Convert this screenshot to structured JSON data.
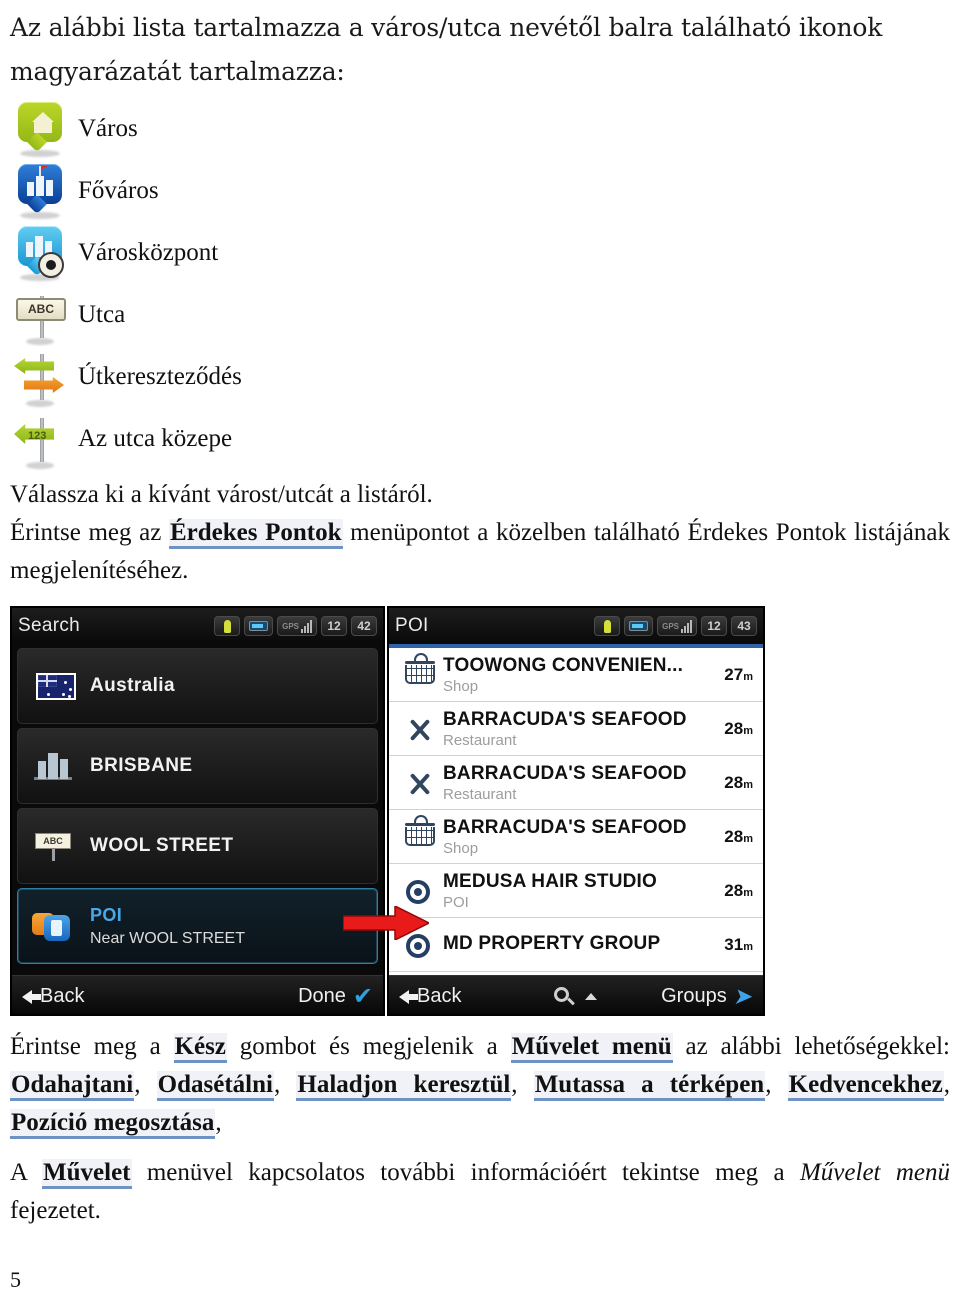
{
  "document": {
    "intro_heading": "Az alábbi lista tartalmazza a város/utca nevétől balra található ikonok magyarázatát tartalmazza:",
    "page_number": "5"
  },
  "icon_legend": {
    "items": [
      {
        "icon": "green-house-pin-icon",
        "label": "Város"
      },
      {
        "icon": "blue-capital-city-pin-icon",
        "label": "Főváros"
      },
      {
        "icon": "cyan-city-centre-pin-icon",
        "label": "Városközpont"
      },
      {
        "icon": "abc-street-sign-icon",
        "label": "Utca",
        "sign_text": "ABC"
      },
      {
        "icon": "junction-arrows-icon",
        "label": "Útkereszteződés"
      },
      {
        "icon": "street-midpoint-arrow-icon",
        "label": "Az utca közepe",
        "sign_text": "123"
      }
    ]
  },
  "paragraphs": {
    "select_city": "Válassza ki a kívánt várost/utcát a listáról.",
    "poi_part1": "Érintse meg az ",
    "poi_link": "Érdekes Pontok",
    "poi_part2": " menüpontot a közelben található Érdekes Pontok listájának megjelenítéséhez.",
    "done_part1": "Érintse meg a ",
    "done_link_kesz": "Kész",
    "done_part2": " gombot és megjelenik a ",
    "done_link_muvelet": "Művelet menü",
    "done_part3": " az alábbi lehetőségekkel: ",
    "done_options": [
      "Odahajtani",
      "Odasétálni",
      "Haladjon keresztül",
      "Mutassa a térképen",
      "Kedvencekhez",
      "Pozíció megosztása"
    ],
    "action_part1": "A ",
    "action_link": "Művelet",
    "action_part2": " menüvel kapcsolatos további információért tekintse meg a ",
    "action_italic": "Művelet menü",
    "action_part3": " fejezetet."
  },
  "devices": {
    "search_screen": {
      "title": "Search",
      "status": {
        "person_icon": "pedestrian-icon",
        "battery_icon": "battery-icon",
        "gps_icon": "gps-signal-icon",
        "gps_label": "GPS",
        "value_1": "12",
        "value_2": "42"
      },
      "rows": [
        {
          "icon": "australia-flag-icon",
          "title": "Australia",
          "subtitle": "",
          "selected": false
        },
        {
          "icon": "city-buildings-icon",
          "title": "BRISBANE",
          "subtitle": "",
          "selected": false
        },
        {
          "icon": "abc-street-sign-icon",
          "title": "WOOL STREET",
          "subtitle": "",
          "sign_text": "ABC",
          "selected": false
        },
        {
          "icon": "poi-fuel-icon",
          "title": "POI",
          "subtitle": "Near WOOL STREET",
          "selected": true
        }
      ],
      "footer": {
        "back": "Back",
        "done": "Done"
      }
    },
    "poi_screen": {
      "title": "POI",
      "status": {
        "person_icon": "pedestrian-icon",
        "battery_icon": "battery-icon",
        "gps_icon": "gps-signal-icon",
        "gps_label": "GPS",
        "value_1": "12",
        "value_2": "43"
      },
      "rows": [
        {
          "icon": "shop-basket-icon",
          "title": "TOOWONG CONVENIEN...",
          "subtitle": "Shop",
          "distance": "27",
          "unit": "m"
        },
        {
          "icon": "restaurant-icon",
          "title": "BARRACUDA'S SEAFOOD",
          "subtitle": "Restaurant",
          "distance": "28",
          "unit": "m"
        },
        {
          "icon": "restaurant-icon",
          "title": "BARRACUDA'S SEAFOOD",
          "subtitle": "Restaurant",
          "distance": "28",
          "unit": "m"
        },
        {
          "icon": "shop-basket-icon",
          "title": "BARRACUDA'S SEAFOOD",
          "subtitle": "Shop",
          "distance": "28",
          "unit": "m"
        },
        {
          "icon": "poi-target-icon",
          "title": "MEDUSA HAIR STUDIO",
          "subtitle": "POI",
          "distance": "28",
          "unit": "m"
        },
        {
          "icon": "poi-target-icon",
          "title": "MD PROPERTY GROUP",
          "subtitle": "",
          "distance": "31",
          "unit": "m"
        }
      ],
      "footer": {
        "back": "Back",
        "search_icon": "magnifier-icon",
        "groups": "Groups"
      }
    },
    "annotation": {
      "arrow_icon": "red-arrow-icon",
      "arrow_color": "#e81a1a"
    }
  }
}
